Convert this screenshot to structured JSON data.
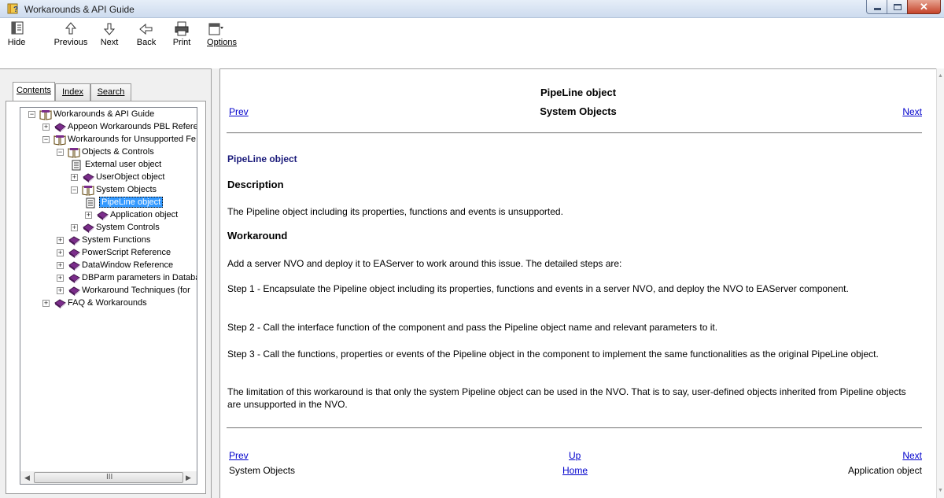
{
  "window": {
    "title": "Workarounds & API Guide"
  },
  "toolbar": {
    "buttons": [
      {
        "label": "Hide",
        "icon": "hide-icon"
      },
      {
        "label": "Previous",
        "icon": "arrow-up-icon"
      },
      {
        "label": "Next",
        "icon": "arrow-down-icon"
      },
      {
        "label": "Back",
        "icon": "arrow-left-icon"
      },
      {
        "label": "Print",
        "icon": "printer-icon"
      },
      {
        "label": "Options",
        "icon": "options-icon"
      }
    ]
  },
  "nav_tabs": {
    "contents": "Contents",
    "index": "Index",
    "search": "Search",
    "active": "Contents"
  },
  "tree": {
    "items": [
      {
        "label": "Workarounds & API Guide",
        "icon": "open-book-icon",
        "expander": "minus"
      },
      {
        "label": "Appeon Workarounds PBL Refere",
        "icon": "closed-book-icon",
        "expander": "plus"
      },
      {
        "label": "Workarounds for Unsupported Fe",
        "icon": "open-book-icon",
        "expander": "minus"
      },
      {
        "label": "Objects & Controls",
        "icon": "open-book-icon",
        "expander": "minus"
      },
      {
        "label": "External user object",
        "icon": "page-icon",
        "expander": "none"
      },
      {
        "label": "UserObject object",
        "icon": "closed-book-icon",
        "expander": "plus"
      },
      {
        "label": "System Objects",
        "icon": "open-book-icon",
        "expander": "minus"
      },
      {
        "label": "PipeLine object",
        "icon": "page-icon",
        "expander": "none",
        "selected": true
      },
      {
        "label": "Application object",
        "icon": "closed-book-icon",
        "expander": "plus"
      },
      {
        "label": "System Controls",
        "icon": "closed-book-icon",
        "expander": "plus"
      },
      {
        "label": "System Functions",
        "icon": "closed-book-icon",
        "expander": "plus"
      },
      {
        "label": "PowerScript Reference",
        "icon": "closed-book-icon",
        "expander": "plus"
      },
      {
        "label": "DataWindow Reference",
        "icon": "closed-book-icon",
        "expander": "plus"
      },
      {
        "label": "DBParm parameters in Databa",
        "icon": "closed-book-icon",
        "expander": "plus"
      },
      {
        "label": "Workaround Techniques (for",
        "icon": "closed-book-icon",
        "expander": "plus"
      },
      {
        "label": "FAQ & Workarounds",
        "icon": "closed-book-icon",
        "expander": "plus"
      }
    ],
    "scroll_grip": "III"
  },
  "header": {
    "title": "PipeLine object",
    "section": "System Objects",
    "prev": "Prev",
    "next": "Next"
  },
  "article": {
    "heading": "PipeLine object",
    "description_heading": "Description",
    "description": "The Pipeline object including its properties, functions and events is unsupported.",
    "workaround_heading": "Workaround",
    "paragraphs": [
      "Add a server NVO and deploy it to EAServer to work around this issue. The detailed steps are:",
      "Step 1 - Encapsulate the Pipeline object including its properties, functions and events in a server NVO, and deploy the NVO to EAServer component.",
      "Step 2 - Call the interface function of the component and pass the Pipeline object name and relevant parameters to it.",
      "Step 3 - Call the functions, properties or events of the Pipeline object in the component to implement the same functionalities as the original PipeLine object.",
      "The limitation of this workaround is that only the system Pipeline object can be used in the NVO. That is to say, user-defined objects inherited from Pipeline objects are unsupported in the NVO."
    ]
  },
  "footer": {
    "prev": "Prev",
    "up": "Up",
    "next": "Next",
    "prev_title": "System Objects",
    "home": "Home",
    "next_title": "Application object"
  },
  "colors": {
    "link": "#0000cc",
    "heading": "#1a1a7a",
    "selection": "#3399ff",
    "book": "#7b2d8b"
  }
}
